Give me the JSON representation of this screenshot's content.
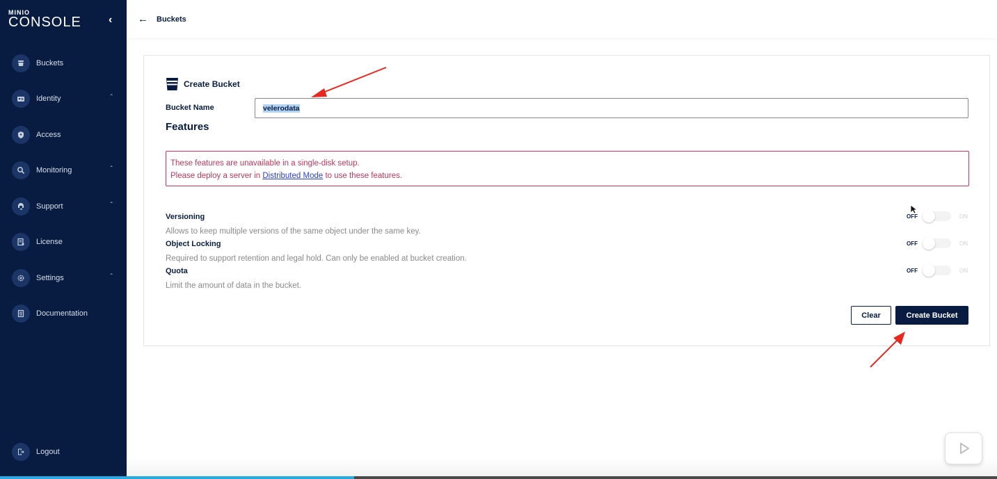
{
  "app": {
    "logo_top": "MINIO",
    "logo_main": "CONSOLE"
  },
  "sidebar": {
    "items": [
      {
        "label": "Buckets",
        "icon": "bucket-icon",
        "expandable": false
      },
      {
        "label": "Identity",
        "icon": "identity-icon",
        "expandable": true
      },
      {
        "label": "Access",
        "icon": "shield-icon",
        "expandable": false
      },
      {
        "label": "Monitoring",
        "icon": "search-icon",
        "expandable": true
      },
      {
        "label": "Support",
        "icon": "support-icon",
        "expandable": true
      },
      {
        "label": "License",
        "icon": "license-icon",
        "expandable": false
      },
      {
        "label": "Settings",
        "icon": "gear-icon",
        "expandable": true
      },
      {
        "label": "Documentation",
        "icon": "document-icon",
        "expandable": false
      }
    ],
    "logout_label": "Logout"
  },
  "header": {
    "breadcrumb": "Buckets"
  },
  "form": {
    "title": "Create Bucket",
    "bucket_name_label": "Bucket Name",
    "bucket_name_value": "velerodata",
    "features_title": "Features",
    "alert_line1": "These features are unavailable in a single-disk setup.",
    "alert_line2_prefix": "Please deploy a server in ",
    "alert_link": "Distributed Mode",
    "alert_line2_suffix": " to use these features.",
    "features": [
      {
        "name": "Versioning",
        "description": "Allows to keep multiple versions of the same object under the same key.",
        "off_label": "OFF",
        "on_label": "ON",
        "enabled": false
      },
      {
        "name": "Object Locking",
        "description": "Required to support retention and legal hold. Can only be enabled at bucket creation.",
        "off_label": "OFF",
        "on_label": "ON",
        "enabled": false
      },
      {
        "name": "Quota",
        "description": "Limit the amount of data in the bucket.",
        "off_label": "OFF",
        "on_label": "ON",
        "enabled": false
      }
    ],
    "clear_label": "Clear",
    "create_label": "Create Bucket"
  },
  "video": {
    "progress_fraction": 0.355
  },
  "colors": {
    "sidebar": "#081c42",
    "accent": "#081c42",
    "alert": "#c0395a",
    "annotation_arrow": "#e8281f",
    "progress": "#27a9e1"
  }
}
